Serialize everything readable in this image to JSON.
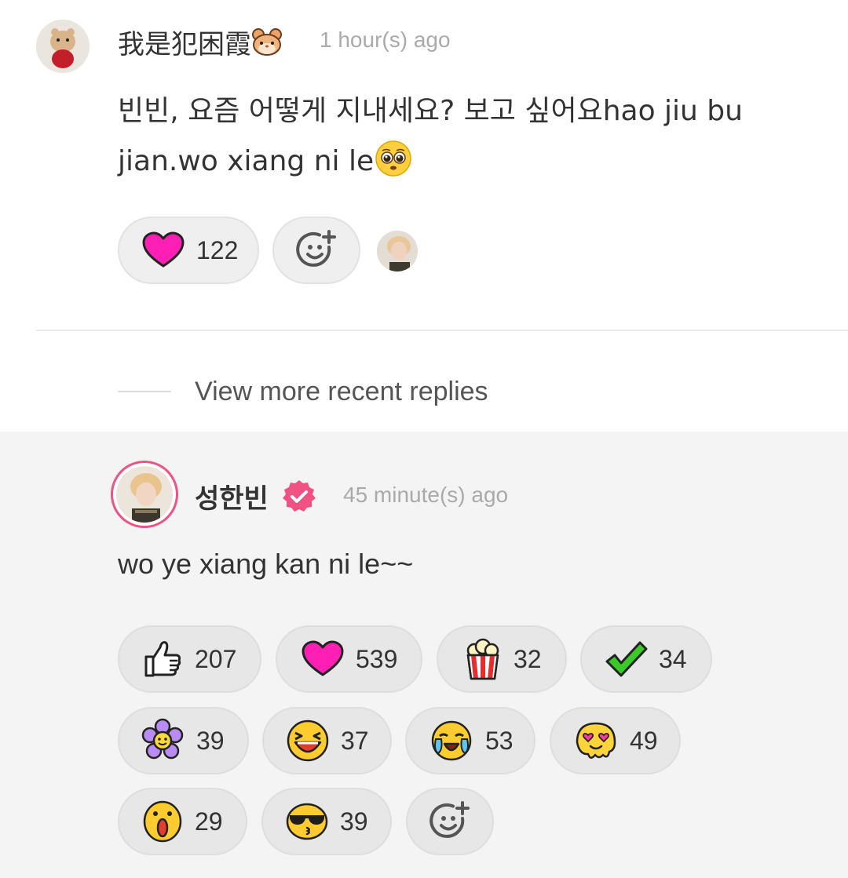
{
  "comment": {
    "username": "我是犯困霞",
    "username_emoji": "hamster-face",
    "time": "1 hour(s) ago",
    "text": "빈빈, 요즘 어떻게 지내세요? 보고 싶어요hao jiu bu jian.wo xiang ni le",
    "text_emoji": "pleading-face",
    "reactions": [
      {
        "icon": "heart-icon",
        "count": "122"
      }
    ],
    "add_reaction_icon": "add-emoji-icon"
  },
  "more_replies_label": "View more recent replies",
  "reply": {
    "username": "성한빈",
    "verified": true,
    "time": "45 minute(s) ago",
    "text": "wo ye xiang kan ni le~~",
    "reactions": [
      {
        "icon": "thumbs-up-icon",
        "count": "207"
      },
      {
        "icon": "heart-icon",
        "count": "539"
      },
      {
        "icon": "popcorn-icon",
        "count": "32"
      },
      {
        "icon": "check-mark-icon",
        "count": "34"
      },
      {
        "icon": "flower-icon",
        "count": "39"
      },
      {
        "icon": "laughing-face-icon",
        "count": "37"
      },
      {
        "icon": "crying-face-icon",
        "count": "53"
      },
      {
        "icon": "melting-love-face-icon",
        "count": "49"
      },
      {
        "icon": "surprised-face-icon",
        "count": "29"
      },
      {
        "icon": "sunglasses-kiss-face-icon",
        "count": "39"
      }
    ],
    "add_reaction_icon": "add-emoji-icon"
  },
  "colors": {
    "accent_pink": "#f05283",
    "heart": "#ff1fb4",
    "pill_bg": "#efefef",
    "reply_bg": "#f4f4f4"
  }
}
